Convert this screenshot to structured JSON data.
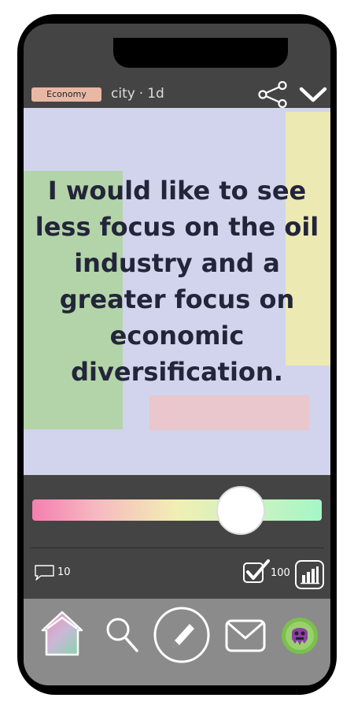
{
  "post": {
    "category": "Economy",
    "location": "city",
    "separator": "·",
    "age": "1d",
    "text": "I would like to see less focus on the oil industry and a greater focus on economic diversification."
  },
  "rating": {
    "value": 0.72
  },
  "stats": {
    "comments": "10",
    "agrees": "100"
  },
  "nav": {
    "items": [
      "home-icon",
      "search-icon",
      "compose-icon",
      "mail-icon",
      "profile-avatar"
    ]
  },
  "colors": {
    "card": "#d1d4ec",
    "tag": "#e9b8a5",
    "screen": "#444444",
    "nav": "#8b8b8b"
  }
}
